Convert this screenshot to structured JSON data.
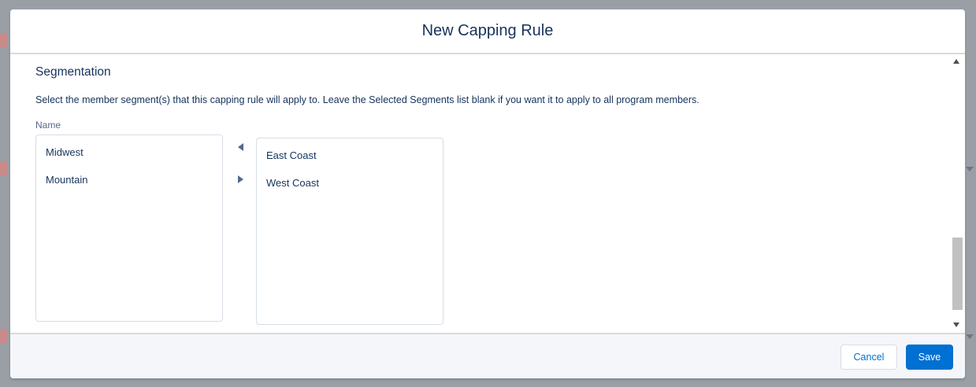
{
  "modal": {
    "title": "New Capping Rule"
  },
  "segmentation": {
    "section_title": "Segmentation",
    "help_text": "Select the member segment(s) that this capping rule will apply to. Leave the Selected Segments list blank if you want it to apply to all program members.",
    "field_label": "Name",
    "available_options": [
      "Midwest",
      "Mountain"
    ],
    "selected_options": [
      "East Coast",
      "West Coast"
    ],
    "move_left_icon": "triangle-left-icon",
    "move_right_icon": "triangle-right-icon"
  },
  "footer": {
    "cancel_label": "Cancel",
    "save_label": "Save"
  },
  "colors": {
    "brand": "#0070d2",
    "text": "#16325c",
    "overlay": "#9a9fa6",
    "footer_bg": "#f4f6f9"
  }
}
